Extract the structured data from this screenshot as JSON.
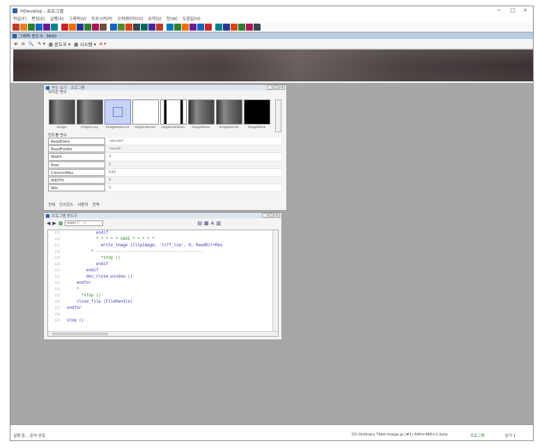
{
  "window": {
    "title": "HDevelop - 프로그램",
    "min_label": "−",
    "max_label": "□",
    "close_label": "×"
  },
  "menu": [
    "파일(F)",
    "편집(E)",
    "실행(X)",
    "그래픽(V)",
    "프로시저(P)",
    "오퍼레이터(O)",
    "요약(S)",
    "창(W)",
    "도움말(H)"
  ],
  "toolbar": {
    "icon_colors": [
      "#c0392b",
      "#e67e22",
      "#2e7d32",
      "#1565c0",
      "#6a1b9a",
      "#00838f",
      "#c62828",
      "#ef6c00",
      "#283593",
      "#2e7d32",
      "#ad1457",
      "#6d4c41",
      "#1565c0",
      "#558b2f",
      "#d84315",
      "#37474f",
      "#00695c",
      "#4527a0",
      "#c0392b",
      "#0277bd",
      "#2e7d32",
      "#ef6c00",
      "#6a1b9a",
      "#1565c0",
      "#c62828",
      "#00838f",
      "#283593",
      "#d84315",
      "#2e7d32",
      "#ad1457",
      "#37474f"
    ]
  },
  "graphics_window": {
    "title": "그래픽 윈도우: 3600",
    "tools": [
      "⊕",
      "⊖",
      "🔍",
      "✎ ▾",
      "▦ 윈도우 ▾",
      "▦ 시스템 ▾",
      "A ▾"
    ]
  },
  "variable_window": {
    "title": "변수 보기 - 프로그램",
    "iconic_label": "아이콘 변수",
    "control_label": "컨트롤 변수",
    "thumbnails": [
      {
        "label": "Image",
        "style": "gradient"
      },
      {
        "label": "ImageGray",
        "style": "gradient"
      },
      {
        "label": "ImageReduced",
        "style": "selected"
      },
      {
        "label": "RegionBorder",
        "style": "white"
      },
      {
        "label": "RegionDilation",
        "style": "stripes"
      },
      {
        "label": "ImageMean",
        "style": "gradient"
      },
      {
        "label": "ImageResult",
        "style": "gradient"
      },
      {
        "label": "ImageMask",
        "style": "black"
      }
    ],
    "rows": [
      {
        "name": "ReadData",
        "value": "'abcdef'"
      },
      {
        "name": "ReadFolder",
        "value": "'result'"
      },
      {
        "name": "Width",
        "value": "0"
      },
      {
        "name": "Row",
        "value": "0"
      },
      {
        "name": "ColumnMax",
        "value": "640"
      },
      {
        "name": "WIDTH",
        "value": "0"
      },
      {
        "name": "Win",
        "value": "0"
      }
    ],
    "tabs": [
      "전체",
      "인스턴스",
      "사용자",
      "전역"
    ]
  },
  "program_window": {
    "title": "프로그램 윈도우",
    "selector": "main ( : : )",
    "code": [
      {
        "no": "115",
        "text": "              endif",
        "kind": "code"
      },
      {
        "no": "116",
        "text": "              * * * * * SAVE * * * * *",
        "kind": "comment"
      },
      {
        "no": "117",
        "text": "                write_image (ClipImage, 'tiff_lzw', 0, ReadDir+Res",
        "kind": "code"
      },
      {
        "no": "118",
        "text": "            * --------------------------------------------",
        "kind": "comment"
      },
      {
        "no": "119",
        "text": "                *stop ()",
        "kind": "comment"
      },
      {
        "no": "120",
        "text": "              endif",
        "kind": "code"
      },
      {
        "no": "121",
        "text": "          endif",
        "kind": "code"
      },
      {
        "no": "122",
        "text": "          dev_close_window ()",
        "kind": "code"
      },
      {
        "no": "123",
        "text": "      endfor",
        "kind": "code"
      },
      {
        "no": "124",
        "text": "      *",
        "kind": "comment"
      },
      {
        "no": "125",
        "text": "        *stop ()",
        "kind": "comment"
      },
      {
        "no": "126",
        "text": "      close_file (FileHandle)",
        "kind": "code"
      },
      {
        "no": "127",
        "text": "  endfor",
        "kind": "code"
      },
      {
        "no": "128",
        "text": "",
        "kind": "code"
      },
      {
        "no": "129",
        "text": "  stop ()",
        "kind": "code"
      }
    ]
  },
  "status": {
    "left": "실행 중... 준비 완료",
    "middle": "[0] Ordinary Tiled Image.jp (#1) 640×480×1 byte",
    "right": "프로그램",
    "far_right": "닫기 1"
  }
}
